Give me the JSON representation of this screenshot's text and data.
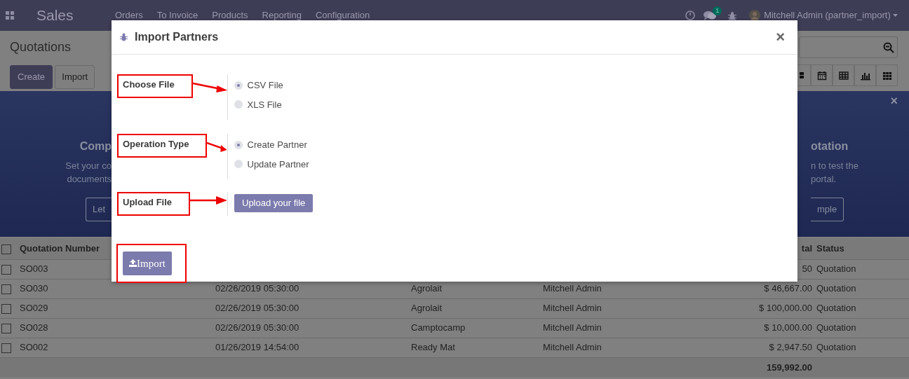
{
  "navbar": {
    "app_name": "Sales",
    "menu": [
      "Orders",
      "To Invoice",
      "Products",
      "Reporting",
      "Configuration"
    ],
    "messages_badge": "1",
    "user": "Mitchell Admin (partner_import)"
  },
  "control_panel": {
    "title": "Quotations",
    "buttons": [
      "Create",
      "Import"
    ]
  },
  "banner": {
    "close": "×",
    "left": {
      "title": "Comp",
      "text_lines": [
        "Set your co",
        "documents"
      ],
      "button": "Let"
    },
    "right": {
      "title": "otation",
      "text_lines": [
        "n to test the",
        "portal."
      ],
      "button": "mple"
    }
  },
  "table": {
    "header": {
      "checked": false,
      "number": "Quotation Number",
      "total": "tal",
      "status": "Status"
    },
    "rows": [
      {
        "checked": false,
        "number": "SO003",
        "total": "50",
        "status": "Quotation"
      },
      {
        "checked": false,
        "number": "SO030",
        "date": "02/26/2019 05:30:00",
        "customer": "Agrolait",
        "salesperson": "Mitchell Admin",
        "total": "$ 46,667.00",
        "status": "Quotation"
      },
      {
        "checked": false,
        "number": "SO029",
        "date": "02/26/2019 05:30:00",
        "customer": "Agrolait",
        "salesperson": "Mitchell Admin",
        "total": "$ 100,000.00",
        "status": "Quotation"
      },
      {
        "checked": false,
        "number": "SO028",
        "date": "02/26/2019 05:30:00",
        "customer": "Camptocamp",
        "salesperson": "Mitchell Admin",
        "total": "$ 10,000.00",
        "status": "Quotation"
      },
      {
        "checked": false,
        "number": "SO002",
        "date": "01/26/2019 14:54:00",
        "customer": "Ready Mat",
        "salesperson": "Mitchell Admin",
        "total": "$ 2,947.50",
        "status": "Quotation"
      }
    ],
    "footer_total": "159,992.00"
  },
  "dialog": {
    "title": "Import Partners",
    "close": "×",
    "fields": [
      {
        "kind": "radio",
        "label": "Choose File",
        "options": [
          {
            "label": "CSV File",
            "selected": true
          },
          {
            "label": "XLS File",
            "selected": false
          }
        ]
      },
      {
        "kind": "radio",
        "label": "Operation Type",
        "options": [
          {
            "label": "Create Partner",
            "selected": true
          },
          {
            "label": "Update Partner",
            "selected": false
          }
        ]
      },
      {
        "kind": "upload",
        "label": "Upload File",
        "button": "Upload your file"
      }
    ],
    "footer_button": "Import"
  }
}
